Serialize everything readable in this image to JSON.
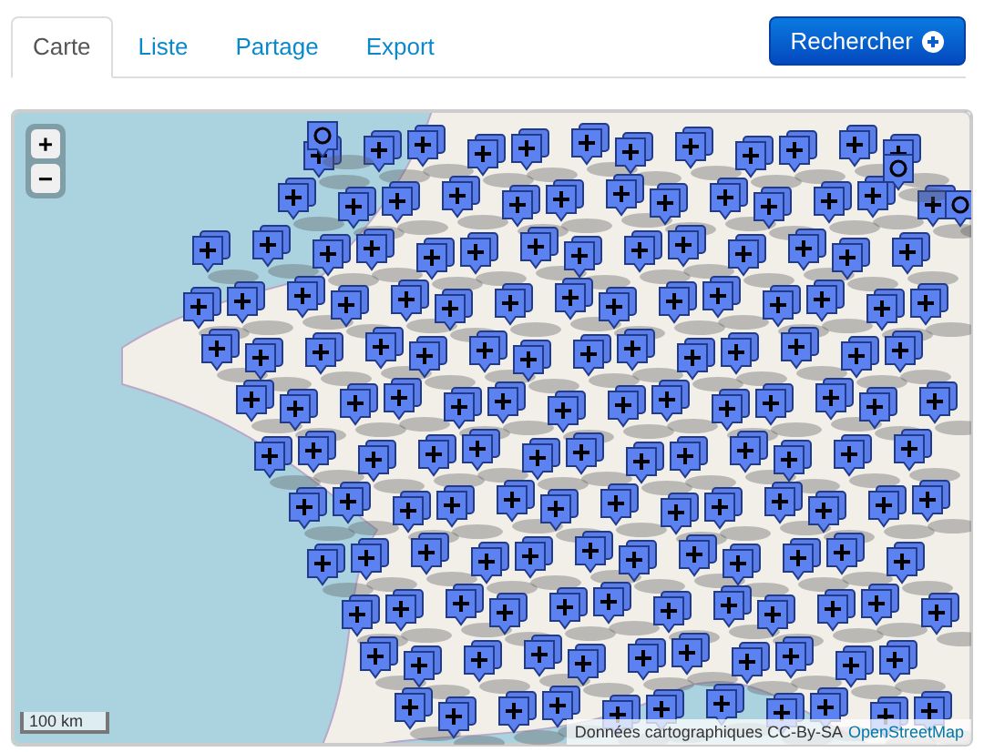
{
  "tabs": [
    {
      "label": "Carte",
      "selected": true
    },
    {
      "label": "Liste",
      "selected": false
    },
    {
      "label": "Partage",
      "selected": false
    },
    {
      "label": "Export",
      "selected": false
    }
  ],
  "search_button": {
    "label": "Rechercher"
  },
  "map": {
    "zoom_in": "+",
    "zoom_out": "−",
    "scale": "100 km",
    "attribution": "Données cartographiques CC-By-SA",
    "attribution_link": "OpenStreetMap"
  }
}
